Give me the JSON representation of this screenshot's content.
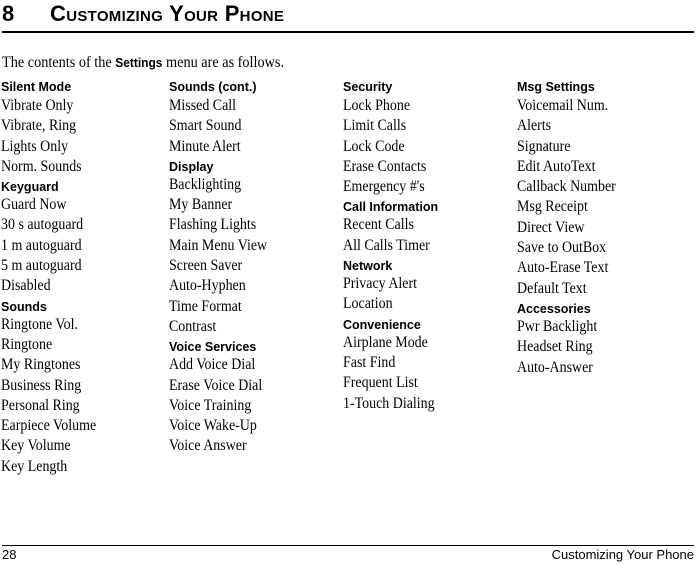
{
  "chapter": {
    "number": "8",
    "title": "Customizing Your Phone"
  },
  "intro": {
    "before": "The contents of the ",
    "menu_name": "Settings",
    "after": " menu are as follows."
  },
  "columns": [
    {
      "groups": [
        {
          "heading": "Silent Mode",
          "items": [
            "Vibrate Only",
            "Vibrate, Ring",
            "Lights Only",
            "Norm. Sounds"
          ]
        },
        {
          "heading": "Keyguard",
          "items": [
            "Guard Now",
            "30 s autoguard",
            "1 m autoguard",
            "5 m autoguard",
            "Disabled"
          ]
        },
        {
          "heading": "Sounds",
          "items": [
            "Ringtone Vol.",
            "Ringtone",
            "My Ringtones",
            "Business Ring",
            "Personal Ring",
            "Earpiece Volume",
            "Key Volume",
            "Key Length"
          ]
        }
      ]
    },
    {
      "groups": [
        {
          "heading": "Sounds (cont.)",
          "items": [
            "Missed Call",
            "Smart Sound",
            "Minute Alert"
          ]
        },
        {
          "heading": "Display",
          "items": [
            "Backlighting",
            "My Banner",
            "Flashing Lights",
            "Main Menu View",
            "Screen Saver",
            "Auto-Hyphen",
            "Time Format",
            "Contrast"
          ]
        },
        {
          "heading": "Voice Services",
          "items": [
            "Add Voice Dial",
            "Erase Voice Dial",
            "Voice Training",
            "Voice Wake-Up",
            "Voice Answer"
          ]
        }
      ]
    },
    {
      "groups": [
        {
          "heading": "Security",
          "items": [
            "Lock Phone",
            "Limit Calls",
            "Lock Code",
            "Erase Contacts",
            "Emergency #'s"
          ]
        },
        {
          "heading": "Call Information",
          "items": [
            "Recent Calls",
            "All Calls Timer"
          ]
        },
        {
          "heading": "Network",
          "items": [
            "Privacy Alert",
            "Location"
          ]
        },
        {
          "heading": "Convenience",
          "items": [
            "Airplane Mode",
            "Fast Find",
            "Frequent List",
            "1-Touch Dialing"
          ]
        }
      ]
    },
    {
      "groups": [
        {
          "heading": "Msg Settings",
          "items": [
            "Voicemail Num.",
            "Alerts",
            "Signature",
            "Edit AutoText",
            "Callback Number",
            "Msg Receipt",
            "Direct View",
            "Save to OutBox",
            "Auto-Erase Text",
            "Default Text"
          ]
        },
        {
          "heading": "Accessories",
          "items": [
            "Pwr Backlight",
            "Headset Ring",
            "Auto-Answer"
          ]
        }
      ]
    }
  ],
  "footer": {
    "page_number": "28",
    "section_title": "Customizing Your Phone"
  }
}
